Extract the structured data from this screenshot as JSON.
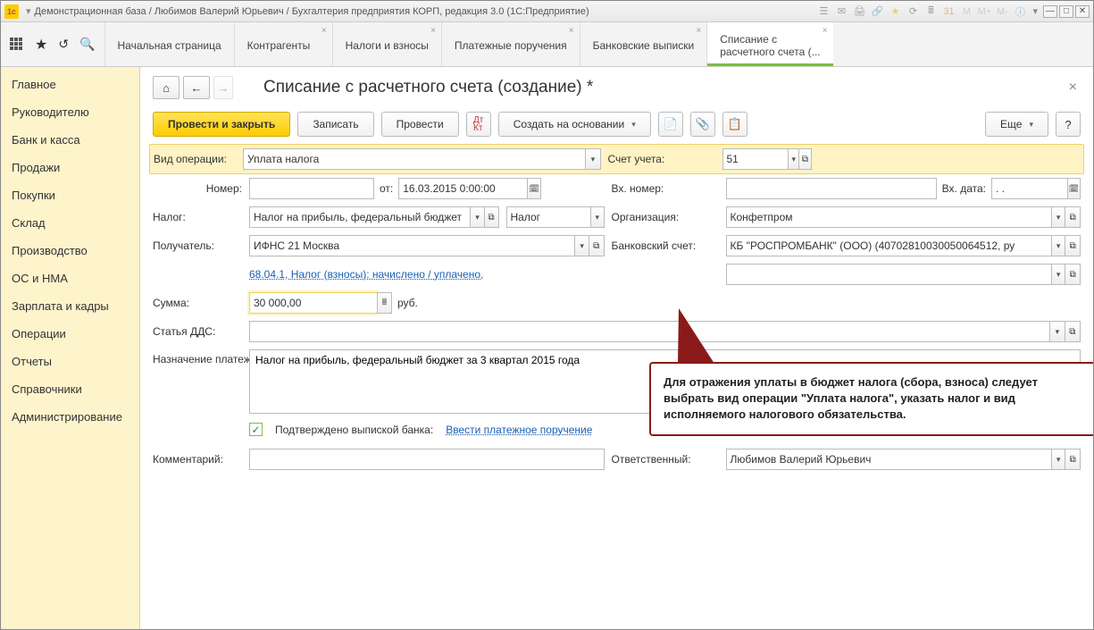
{
  "titlebar": {
    "text": "Демонстрационная база / Любимов Валерий Юрьевич / Бухгалтерия предприятия КОРП, редакция 3.0  (1С:Предприятие)"
  },
  "tabs": {
    "t0": "Начальная страница",
    "t1": "Контрагенты",
    "t2": "Налоги и взносы",
    "t3": "Платежные поручения",
    "t4": "Банковские выписки",
    "t5a": "Списание с",
    "t5b": "расчетного счета (..."
  },
  "sidebar": {
    "i0": "Главное",
    "i1": "Руководителю",
    "i2": "Банк и касса",
    "i3": "Продажи",
    "i4": "Покупки",
    "i5": "Склад",
    "i6": "Производство",
    "i7": "ОС и НМА",
    "i8": "Зарплата и кадры",
    "i9": "Операции",
    "i10": "Отчеты",
    "i11": "Справочники",
    "i12": "Администрирование"
  },
  "page": {
    "title": "Списание с расчетного счета (создание) *"
  },
  "toolbar": {
    "primary": "Провести и закрыть",
    "save": "Записать",
    "post": "Провести",
    "createBased": "Создать на основании",
    "more": "Еще",
    "help": "?"
  },
  "labels": {
    "opType": "Вид операции:",
    "account": "Счет учета:",
    "number": "Номер:",
    "from": "от:",
    "incNumber": "Вх. номер:",
    "incDate": "Вх. дата:",
    "tax": "Налог:",
    "org": "Организация:",
    "recipient": "Получатель:",
    "bankAcc": "Банковский счет:",
    "dds": "Статья ДДС:",
    "sum": "Сумма:",
    "purpose": "Назначение платежа:",
    "comment": "Комментарий:",
    "responsible": "Ответственный:",
    "confirmed": "Подтверждено выпиской банка:",
    "enterOrder": "Ввести платежное поручение",
    "rub": "руб."
  },
  "values": {
    "opType": "Уплата налога",
    "account": "51",
    "date": "16.03.2015  0:00:00",
    "incDate": ".  .",
    "tax": "Налог на прибыль, федеральный бюджет",
    "taxType": "Налог",
    "org": "Конфетпром",
    "recipient": "ИФНС 21 Москва",
    "bankAcc": "КБ \"РОСПРОМБАНК\" (ООО) (40702810030050064512, ру",
    "taxLink": "68.04.1, Налог (взносы): начислено / уплачено,",
    "sum": "30 000,00",
    "purpose": "Налог на прибыль, федеральный бюджет за 3 квартал 2015 года",
    "responsible": "Любимов Валерий Юрьевич"
  },
  "callout": {
    "text": "Для отражения уплаты в бюджет налога (сбора, взноса) следует выбрать вид операции \"Уплата налога\", указать налог и вид исполняемого налогового обязательства."
  }
}
